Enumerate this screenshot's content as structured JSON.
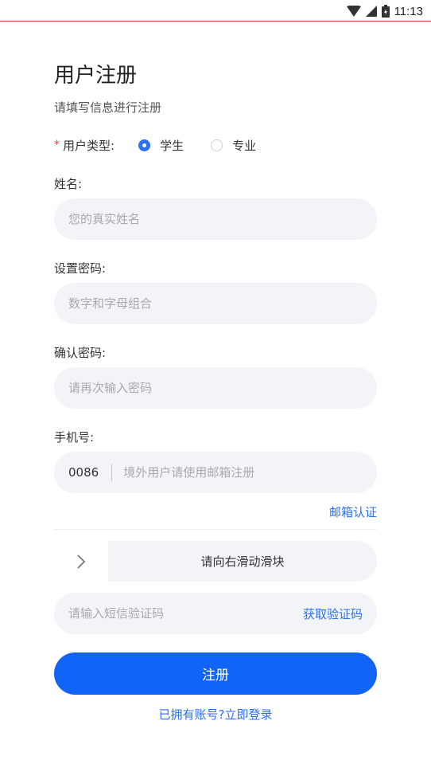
{
  "status_bar": {
    "time": "11:13",
    "icons": [
      "wifi-icon",
      "cellular-signal-icon",
      "battery-icon"
    ]
  },
  "header": {
    "title": "用户注册",
    "subtitle": "请填写信息进行注册"
  },
  "user_type": {
    "required_mark": "*",
    "label": "用户类型:",
    "options": [
      {
        "label": "学生",
        "selected": true
      },
      {
        "label": "专业",
        "selected": false
      }
    ]
  },
  "name": {
    "label": "姓名:",
    "placeholder": "您的真实姓名"
  },
  "password": {
    "label": "设置密码:",
    "placeholder": "数字和字母组合"
  },
  "confirm_password": {
    "label": "确认密码:",
    "placeholder": "请再次输入密码"
  },
  "phone": {
    "label": "手机号:",
    "prefix": "0086",
    "placeholder": "境外用户请使用邮箱注册"
  },
  "email_link": "邮箱认证",
  "slider": {
    "text": "请向右滑动滑块",
    "handle_icon": "chevron-right-icon"
  },
  "sms": {
    "placeholder": "请输入短信验证码",
    "button": "获取验证码"
  },
  "submit": {
    "label": "注册"
  },
  "login_link": "已拥有账号?立即登录",
  "colors": {
    "accent": "#1264f6",
    "link": "#2b6ff2",
    "field_bg": "#f3f4f8",
    "required": "#e23b3b"
  }
}
